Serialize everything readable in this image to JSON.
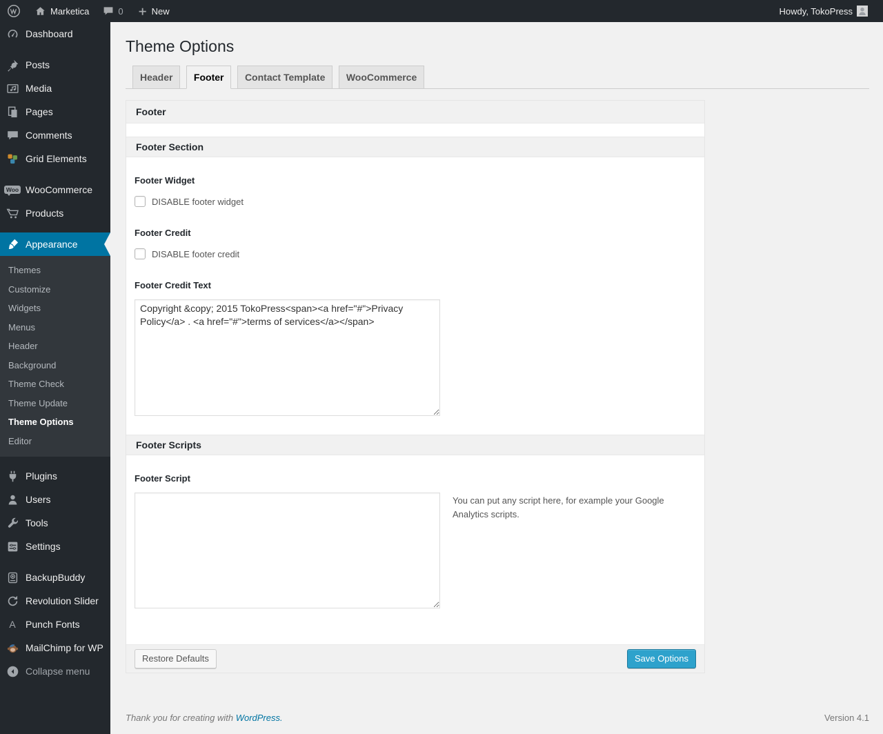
{
  "colors": {
    "admin_bar_bg": "#23282d",
    "sidebar_bg": "#23282d",
    "submenu_bg": "#32373c",
    "menu_highlight_blue": "#0074a2",
    "primary_button_bg": "#2ea2cc",
    "link_blue": "#0074a2",
    "page_bg": "#f1f1f1"
  },
  "admin_bar": {
    "wp_logo_icon": "wordpress-logo-icon",
    "home_icon": "home-icon",
    "site_name": "Marketica",
    "comments_icon": "comment-bubble-icon",
    "comments_count": "0",
    "new_icon": "plus-icon",
    "new_label": "New",
    "howdy_text": "Howdy, TokoPress",
    "avatar_icon": "user-avatar"
  },
  "sidebar": {
    "items": [
      {
        "label": "Dashboard",
        "icon": "dashboard-gauge-icon"
      },
      {
        "label": "Posts",
        "icon": "pushpin-icon"
      },
      {
        "label": "Media",
        "icon": "media-notes-icon"
      },
      {
        "label": "Pages",
        "icon": "pages-icon"
      },
      {
        "label": "Comments",
        "icon": "comment-bubble-icon"
      },
      {
        "label": "Grid Elements",
        "icon": "grid-elements-color-icon"
      },
      {
        "label": "WooCommerce",
        "icon": "woocommerce-badge-icon",
        "badge": "Woo"
      },
      {
        "label": "Products",
        "icon": "shopping-cart-icon"
      },
      {
        "label": "Appearance",
        "icon": "paintbrush-icon",
        "current": true
      },
      {
        "label": "Plugins",
        "icon": "plug-icon"
      },
      {
        "label": "Users",
        "icon": "person-icon"
      },
      {
        "label": "Tools",
        "icon": "wrench-icon"
      },
      {
        "label": "Settings",
        "icon": "sliders-icon"
      },
      {
        "label": "BackupBuddy",
        "icon": "backup-drive-icon"
      },
      {
        "label": "Revolution Slider",
        "icon": "refresh-arrows-icon"
      },
      {
        "label": "Punch Fonts",
        "icon": "letter-a-icon",
        "glyph": "A"
      },
      {
        "label": "MailChimp for WP",
        "icon": "mailchimp-monkey-icon"
      },
      {
        "label": "Collapse menu",
        "icon": "collapse-arrow-icon"
      }
    ],
    "appearance_submenu": [
      "Themes",
      "Customize",
      "Widgets",
      "Menus",
      "Header",
      "Background",
      "Theme Check",
      "Theme Update",
      "Theme Options",
      "Editor"
    ],
    "current_submenu_item": "Theme Options"
  },
  "page": {
    "title": "Theme Options",
    "tabs": [
      {
        "label": "Header",
        "active": false
      },
      {
        "label": "Footer",
        "active": true
      },
      {
        "label": "Contact Template",
        "active": false
      },
      {
        "label": "WooCommerce",
        "active": false
      }
    ]
  },
  "panel": {
    "header": "Footer",
    "section1_title": "Footer Section",
    "footer_widget_label": "Footer Widget",
    "footer_widget_checkbox_label": "DISABLE footer widget",
    "footer_widget_checked": false,
    "footer_credit_label": "Footer Credit",
    "footer_credit_checkbox_label": "DISABLE footer credit",
    "footer_credit_checked": false,
    "footer_credit_text_label": "Footer Credit Text",
    "footer_credit_text_value": "Copyright &copy; 2015 TokoPress<span><a href=\"#\">Privacy Policy</a> . <a href=\"#\">terms of services</a></span>",
    "section2_title": "Footer Scripts",
    "footer_script_label": "Footer Script",
    "footer_script_value": "",
    "footer_script_help": "You can put any script here, for example your Google Analytics scripts.",
    "restore_button_label": "Restore Defaults",
    "save_button_label": "Save Options"
  },
  "footer": {
    "thanks_text": "Thank you for creating with",
    "wordpress_link": "WordPress.",
    "version": "Version 4.1"
  }
}
